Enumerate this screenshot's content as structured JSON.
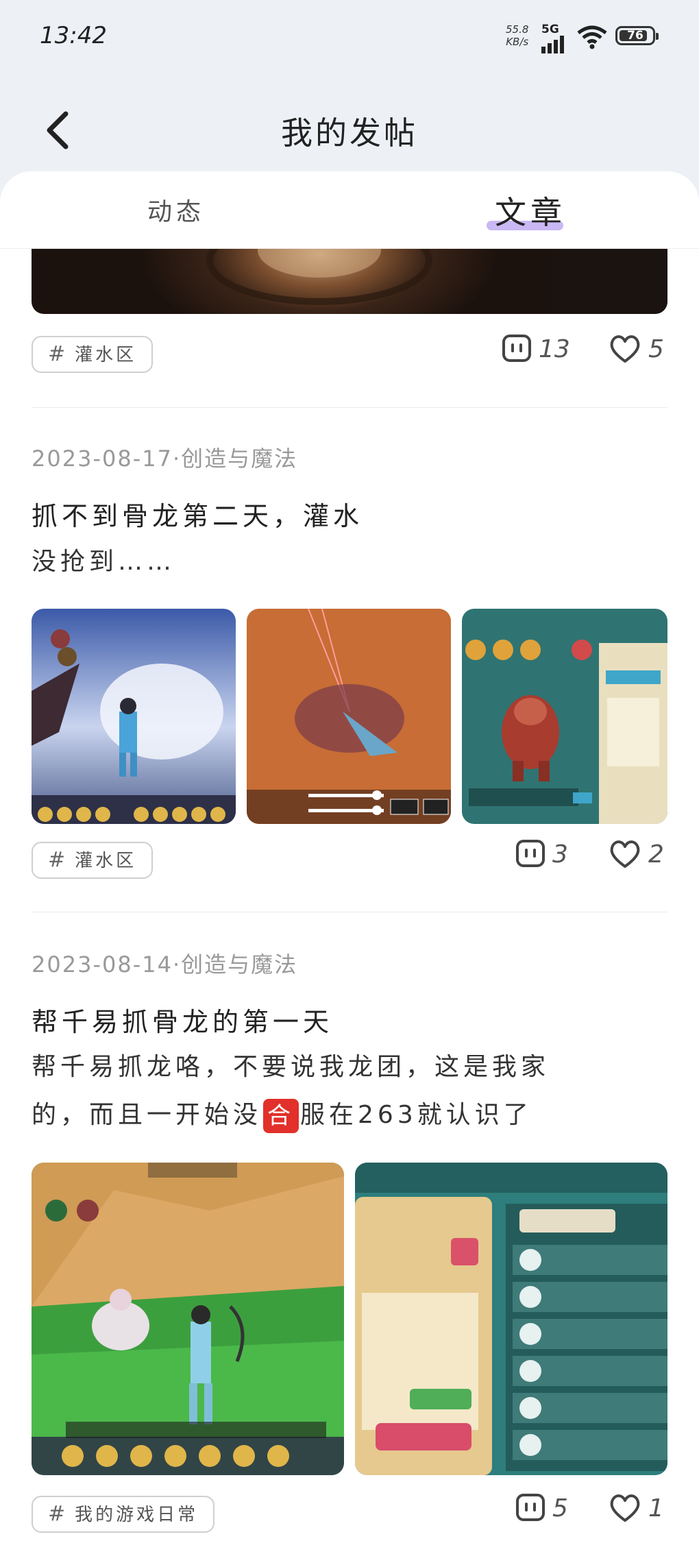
{
  "status_bar": {
    "time": "13:42",
    "net_speed": "55.8",
    "net_unit": "KB/s",
    "network": "5G",
    "battery": "76"
  },
  "header": {
    "title": "我的发帖"
  },
  "tabs": [
    {
      "label": "动态",
      "active": false
    },
    {
      "label": "文章",
      "active": true
    }
  ],
  "posts": [
    {
      "tag": "灌水区",
      "comments": "13",
      "likes": "5"
    },
    {
      "meta": "2023-08-17·创造与魔法",
      "title": "抓不到骨龙第二天，灌水",
      "body": "没抢到……",
      "images": [
        "game-screenshot-ice-area",
        "game-screenshot-battle",
        "game-screenshot-dragon-info"
      ],
      "tag": "灌水区",
      "comments": "3",
      "likes": "2"
    },
    {
      "meta": "2023-08-14·创造与魔法",
      "title": "帮千易抓骨龙的第一天",
      "body_line1": "帮千易抓龙咯，不要说我龙团，这是我家",
      "body_line2a": "的，而且一开始没",
      "body_emoji": "合",
      "body_line2b": "服在263就认识了",
      "images": [
        "game-screenshot-grassland",
        "game-screenshot-family-members"
      ],
      "tag": "我的游戏日常",
      "comments": "5",
      "likes": "1"
    }
  ],
  "colors": {
    "background": "#edf1f6",
    "panel": "#ffffff",
    "tab_underline": "#c9b8f4",
    "meta_text": "#999999",
    "emoji_bg": "#e2302a"
  }
}
